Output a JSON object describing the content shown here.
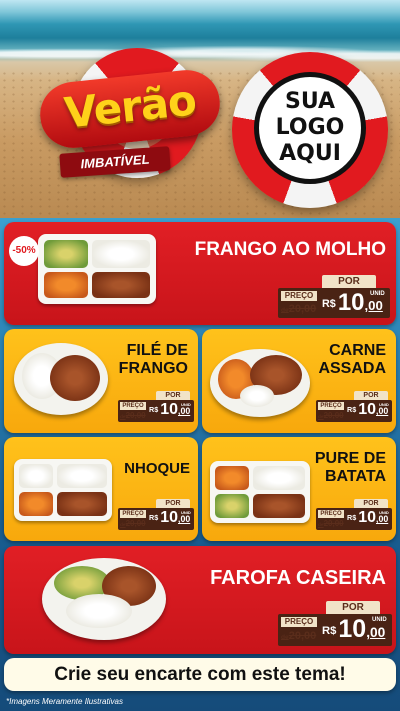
{
  "header": {
    "brand_word": "Verão",
    "brand_tag": "IMBATÍVEL",
    "logo_lines": [
      "SUA",
      "LOGO",
      "AQUI"
    ]
  },
  "items": [
    {
      "name": "FRANGO AO MOLHO",
      "badge": "-50%",
      "por": "POR",
      "preco": "PREÇO",
      "de": "de",
      "old": "20,00",
      "rs": "R$",
      "int": "10",
      "cents": ",00",
      "unid": "UNID"
    },
    {
      "name_lines": [
        "FILÉ DE",
        "FRANGO"
      ],
      "por": "POR",
      "preco": "PREÇO",
      "de": "de",
      "old": "20,00",
      "rs": "R$",
      "int": "10",
      "cents": ",00",
      "unid": "UNID"
    },
    {
      "name_lines": [
        "CARNE",
        "ASSADA"
      ],
      "por": "POR",
      "preco": "PREÇO",
      "de": "de",
      "old": "20,00",
      "rs": "R$",
      "int": "10",
      "cents": ",00",
      "unid": "UNID"
    },
    {
      "name": "NHOQUE",
      "por": "POR",
      "preco": "PREÇO",
      "de": "de",
      "old": "20,00",
      "rs": "R$",
      "int": "10",
      "cents": ",00",
      "unid": "UNID"
    },
    {
      "name_lines": [
        "PURE DE",
        "BATATA"
      ],
      "por": "POR",
      "preco": "PREÇO",
      "de": "de",
      "old": "20,00",
      "rs": "R$",
      "int": "10",
      "cents": ",00",
      "unid": "UNID"
    },
    {
      "name": "FAROFA CASEIRA",
      "por": "POR",
      "preco": "PREÇO",
      "de": "de",
      "old": "20,00",
      "rs": "R$",
      "int": "10",
      "cents": ",00",
      "unid": "UNID"
    }
  ],
  "cta": "Crie seu encarte com este tema!",
  "disclaimer": "*Imagens Meramente Ilustrativas",
  "colors": {
    "red": "#e11f25",
    "yellow": "#ffc21b",
    "price_brown": "#4a2314",
    "price_cream": "#f1e3c8"
  }
}
